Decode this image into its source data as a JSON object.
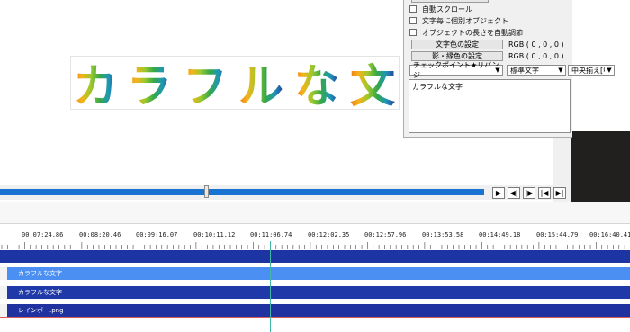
{
  "banner": {
    "glyphs": [
      "カ",
      "ラ",
      "フ",
      "ル",
      "な",
      "文"
    ],
    "colors": [
      "#f07d17",
      "#f3b41a",
      "#9cc82c",
      "#35a848",
      "#1f96b8",
      "#283a9c"
    ]
  },
  "dialog": {
    "checkboxes": [
      {
        "label": "自動スクロール",
        "checked": false
      },
      {
        "label": "文字毎に個別オブジェクト",
        "checked": false
      },
      {
        "label": "オブジェクトの長さを自動調節",
        "checked": false
      }
    ],
    "text_color_button": "文字色の設定",
    "text_color_value": "RGB ( 0 , 0 , 0 )",
    "shadow_color_button": "影・縁色の設定",
    "shadow_color_value": "RGB ( 0 , 0 , 0 )",
    "font_select": "チェックポイント★リバンジ",
    "style_select": "標準文字",
    "align_select": "中央揃え[中]",
    "text_content": "カラフルな文字"
  },
  "playback": {
    "progress": 0.426,
    "buttons": [
      "play",
      "prev-frame",
      "next-frame",
      "go-start",
      "go-end"
    ]
  },
  "timeline": {
    "ticks": [
      {
        "label": "00:07:24.86"
      },
      {
        "label": "00:08:20.46"
      },
      {
        "label": "00:09:16.07"
      },
      {
        "label": "00:10:11.12"
      },
      {
        "label": "00:11:06.74"
      },
      {
        "label": "00:12:02.35"
      },
      {
        "label": "00:12:57.96"
      },
      {
        "label": "00:13:53.58"
      },
      {
        "label": "00:14:49.18"
      },
      {
        "label": "00:15:44.79"
      },
      {
        "label": "00:16:40.41"
      }
    ],
    "clips": [
      {
        "label": "",
        "color": "#1d35a3"
      },
      {
        "label": "カラフルな文字",
        "color": "#4c8ff2"
      },
      {
        "label": "カラフルな文字",
        "color": "#1f3aa8"
      },
      {
        "label": "レインボー.png",
        "color": "#1f32a0"
      }
    ]
  }
}
